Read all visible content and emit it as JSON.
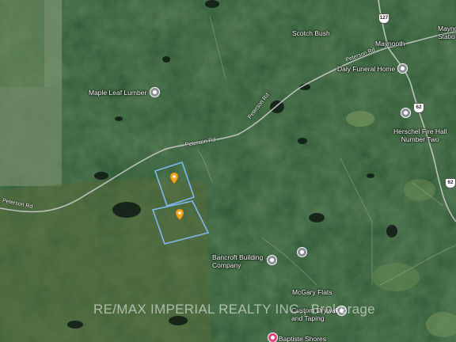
{
  "map": {
    "places": {
      "scotch_bush": "Scotch Bush",
      "maynooth": "Maynooth",
      "maynooth_station": "Mayno\nStatio",
      "maple_leaf_lumber": "Maple Leaf Lumber",
      "daly_funeral_home": "Daly Funeral Home",
      "herschel_fire_hall": "Herschel Fire Hall\nNumber Two",
      "bancroft_building": "Bancroft Building\nCompany",
      "mcgary_flats": "McGary Flats",
      "custom_drywall": "Custom Drywall\nand Taping",
      "baptiste_shores": "Baptiste Shores"
    },
    "roads": {
      "peterson_rd_1": "Peterson Rd",
      "peterson_rd_2": "Peterson Rd",
      "peterson_rd_3": "Peterson Rd",
      "peterson_rd_4": "Peterson Rd"
    },
    "shields": {
      "hwy_127": "127",
      "hwy_62_a": "62",
      "hwy_62_b": "62"
    },
    "watermark": "RE/MAX IMPERIAL REALTY INC., Brokerage",
    "colors": {
      "property_outline": "#7fb8f0",
      "marker": "#f2a51f",
      "poi_gray": "#8a8f96",
      "poi_pink": "#e0427a",
      "road": "#c9c9c9"
    }
  }
}
